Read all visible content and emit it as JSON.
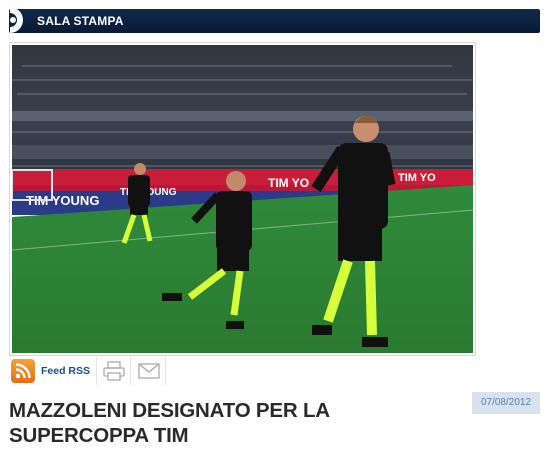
{
  "header": {
    "title": "SALA STAMPA"
  },
  "photo": {
    "banner_texts": [
      "TIM YOUNG",
      "TIM YOUNG",
      "TIM YO",
      "TIM YO"
    ],
    "alt_subject": "referees jogging on pitch"
  },
  "toolbar": {
    "rss_label": "Feed RSS",
    "icons": [
      "rss-icon",
      "print-icon",
      "mail-icon"
    ]
  },
  "article": {
    "date": "07/08/2012",
    "title": "MAZZOLENI DESIGNATO PER LA SUPERCOPPA TIM"
  },
  "colors": {
    "header_bg": "#0b2244",
    "accent_orange": "#ee8a1f",
    "date_bg": "#d7e2ee",
    "date_text": "#5a7fb0",
    "link_blue": "#1b4c8a"
  }
}
